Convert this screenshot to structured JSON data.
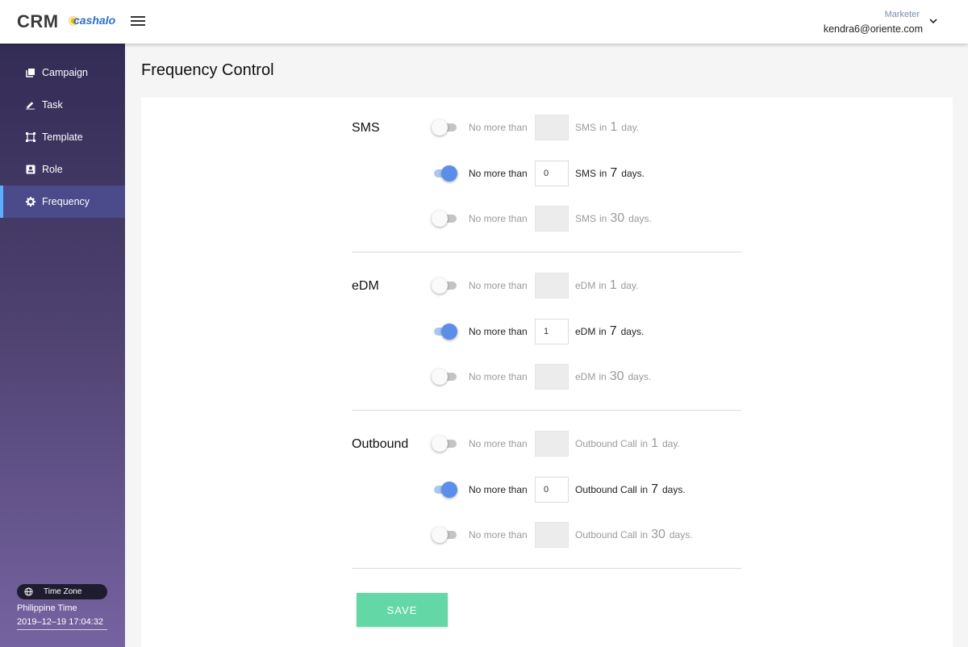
{
  "header": {
    "logo_crm": "CRM",
    "logo_brand": "cashalo",
    "user_role": "Marketer",
    "user_email": "kendra6@oriente.com"
  },
  "sidebar": {
    "items": [
      {
        "label": "Campaign",
        "icon": "campaign-icon"
      },
      {
        "label": "Task",
        "icon": "pen-icon"
      },
      {
        "label": "Template",
        "icon": "template-icon"
      },
      {
        "label": "Role",
        "icon": "id-card-icon"
      },
      {
        "label": "Frequency",
        "icon": "gear-icon",
        "active": true
      }
    ],
    "timezone": {
      "badge_label": "Time Zone",
      "zone_name": "Philippine Time",
      "datetime": "2019–12–19 17:04:32"
    }
  },
  "page": {
    "title": "Frequency Control",
    "save_label": "SAVE",
    "label": "No more than",
    "sections": [
      {
        "title": "SMS",
        "unit": "SMS",
        "rows": [
          {
            "enabled": false,
            "value": "",
            "period": "1",
            "suffix": "day."
          },
          {
            "enabled": true,
            "value": "0",
            "period": "7",
            "suffix": "days."
          },
          {
            "enabled": false,
            "value": "",
            "period": "30",
            "suffix": "days."
          }
        ]
      },
      {
        "title": "eDM",
        "unit": "eDM",
        "rows": [
          {
            "enabled": false,
            "value": "",
            "period": "1",
            "suffix": "day."
          },
          {
            "enabled": true,
            "value": "1",
            "period": "7",
            "suffix": "days."
          },
          {
            "enabled": false,
            "value": "",
            "period": "30",
            "suffix": "days."
          }
        ]
      },
      {
        "title": "Outbound",
        "unit": "Outbound Call",
        "rows": [
          {
            "enabled": false,
            "value": "",
            "period": "1",
            "suffix": "day."
          },
          {
            "enabled": true,
            "value": "0",
            "period": "7",
            "suffix": "days."
          },
          {
            "enabled": false,
            "value": "",
            "period": "30",
            "suffix": "days."
          }
        ]
      }
    ]
  },
  "colors": {
    "toggle_on": "#5b8ee8",
    "save_button": "#63d8a6",
    "sidebar_active_bar": "#5ab0ff"
  }
}
